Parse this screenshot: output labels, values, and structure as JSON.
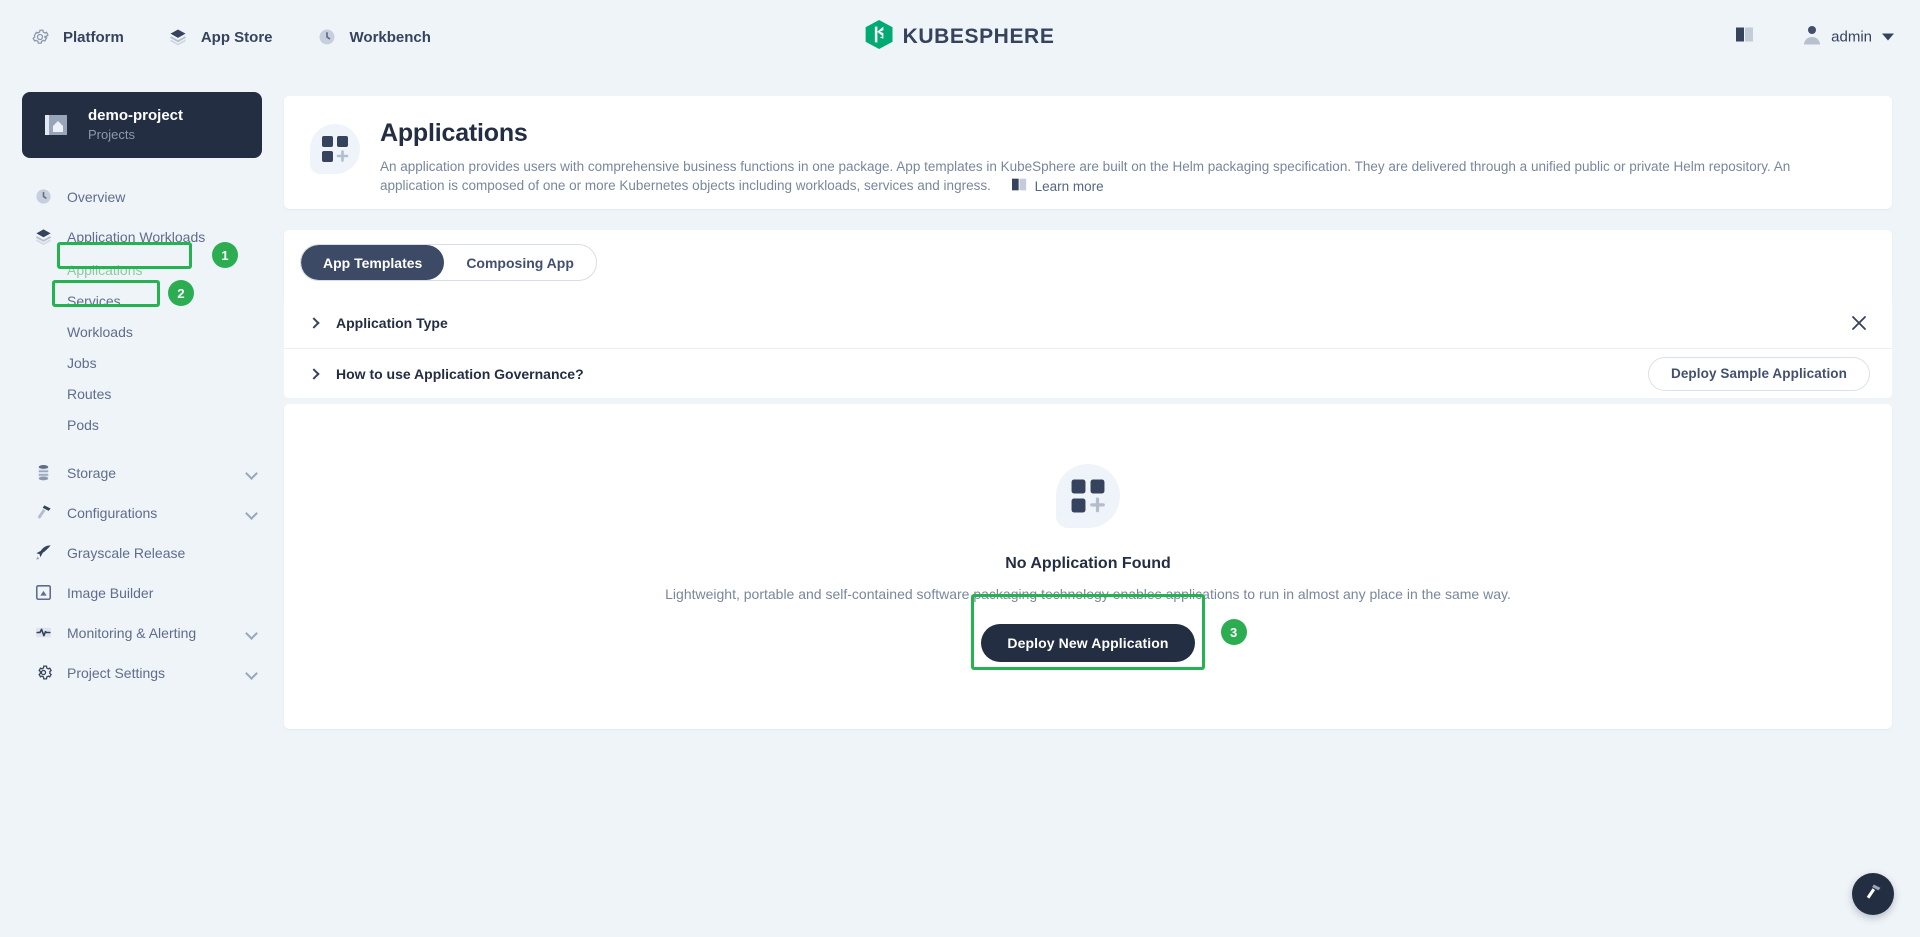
{
  "topnav": {
    "items": [
      {
        "label": "Platform",
        "icon": "gear-icon"
      },
      {
        "label": "App Store",
        "icon": "layers-icon"
      },
      {
        "label": "Workbench",
        "icon": "clock-icon"
      }
    ],
    "brand": {
      "text": "KUBESPHERE",
      "icon": "kubesphere-logo-icon",
      "color": "#00aa72"
    },
    "docs_icon": "book-icon",
    "user": {
      "name": "admin",
      "avatar_icon": "user-avatar-icon",
      "caret_icon": "chevron-down-icon"
    }
  },
  "sidebar": {
    "project": {
      "name": "demo-project",
      "subtitle": "Projects",
      "icon": "project-icon"
    },
    "items": [
      {
        "label": "Overview",
        "icon": "clock-icon",
        "type": "item",
        "expandable": false
      },
      {
        "label": "Application Workloads",
        "icon": "layers-icon",
        "type": "group",
        "expandable": true,
        "expanded": true,
        "highlighted": true,
        "badge": "1"
      },
      {
        "label": "Applications",
        "type": "sub",
        "active": true,
        "highlighted": true,
        "badge": "2"
      },
      {
        "label": "Services",
        "type": "sub"
      },
      {
        "label": "Workloads",
        "type": "sub"
      },
      {
        "label": "Jobs",
        "type": "sub"
      },
      {
        "label": "Routes",
        "type": "sub"
      },
      {
        "label": "Pods",
        "type": "sub"
      },
      {
        "label": "Storage",
        "icon": "database-icon",
        "type": "item",
        "expandable": true
      },
      {
        "label": "Configurations",
        "icon": "hammer-icon",
        "type": "item",
        "expandable": true
      },
      {
        "label": "Grayscale Release",
        "icon": "rocket-icon",
        "type": "item",
        "expandable": false
      },
      {
        "label": "Image Builder",
        "icon": "image-icon",
        "type": "item",
        "expandable": false
      },
      {
        "label": "Monitoring & Alerting",
        "icon": "pulse-icon",
        "type": "item",
        "expandable": true
      },
      {
        "label": "Project Settings",
        "icon": "gear-icon",
        "type": "item",
        "expandable": true
      }
    ]
  },
  "header": {
    "icon": "applications-icon",
    "title": "Applications",
    "description": "An application provides users with comprehensive business functions in one package. App templates in KubeSphere are built on the Helm packaging specification. They are delivered through a unified public or private Helm repository. An application is composed of one or more Kubernetes objects including workloads, services and ingress.",
    "learn_more": "Learn more",
    "learn_more_icon": "book-icon"
  },
  "tabs": [
    {
      "label": "App Templates",
      "active": true
    },
    {
      "label": "Composing App",
      "active": false
    }
  ],
  "accordion": [
    {
      "label": "Application Type",
      "chevron": "chevron-right-icon",
      "close_icon": "close-icon"
    },
    {
      "label": "How to use Application Governance?",
      "chevron": "chevron-right-icon",
      "action": "Deploy Sample Application"
    }
  ],
  "empty_state": {
    "icon": "applications-icon",
    "title": "No Application Found",
    "description": "Lightweight, portable and self-contained software packaging technology enables applications to run in almost any place in the same way.",
    "action": "Deploy New Application",
    "badge": "3"
  },
  "fab": {
    "icon": "hammer-icon"
  },
  "colors": {
    "page_bg": "#eff4f9",
    "dark": "#242e42",
    "accent_green": "#2dad52",
    "brand_green": "#00aa72",
    "muted_text": "#79879c"
  }
}
